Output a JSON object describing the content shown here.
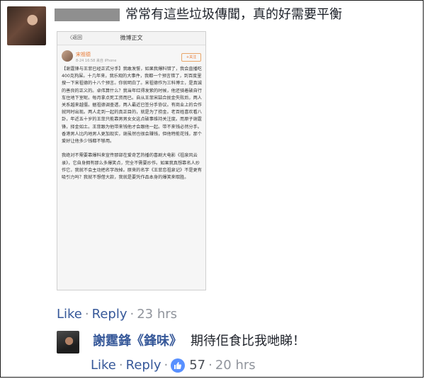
{
  "comment": {
    "text": "常常有這些垃圾傳聞，真的好需要平衡",
    "attachment": {
      "back_label": "〈返回",
      "title": "微博正文",
      "profile_name": "宋祖德",
      "profile_meta": "8-24 16:58 来自 iPhone",
      "follow_label": "+关注",
      "body": "【谢霆锋与王菲已经正式分手】我敢发誓，如果我爆料错了，我会直播吃400克狗屎。十几年来，我乐观的大事件，我都一个预言错了，到百度里搜一下宋祖德的十八个预言。你就明白了。宋祖德作为三科博士，是真诚的善良的正义的。卓伟算什么？我当年红得发紫的时候，他还骑着破自行车住地下室呢。每月拿点死工资而已。自从王菲宋喆合拢金失败后，两人关系越来越僵。据祖德调查透，两人最近已签分手协议。有商业上的合作就同时出现。两人走到一起的真正目的，就是为了捞金。老百姓喜欢看八卦，年近五十岁的王菲只能靠男男女女这点破事维持关注度。而原子谢霆锋，择金如土。王菲跟为他带来钱他才会跟他一起。带不来钱必然分手。香港男人比内地男人更加现实，谢虽然也很会赚钱，但他特能花钱，那个爱好让他多少钱都不够用。\n\n我绝对不需要靠爆料来宣传那部在爱奇艺热播的喜剧大电影《祖泉风云录》，它自身拥有那么多爆笑点，完全不需要炒作。如果我真想靠名人炒作它，我就不会主动把名字改掉。原来的名字《王菲恋祖泉记》不是更有吸引力吗？我就不想借大款，我就是要凭作品本身的爆笑来取胜。"
    },
    "actions": {
      "like": "Like",
      "reply": "Reply",
      "time": "23 hrs"
    }
  },
  "reply": {
    "name": "謝霆鋒《鋒味》",
    "text": "期待佢食比我哋睇！",
    "actions": {
      "like": "Like",
      "reply": "Reply",
      "count": "57",
      "time": "20 hrs"
    },
    "like_color": "#5890ff"
  }
}
